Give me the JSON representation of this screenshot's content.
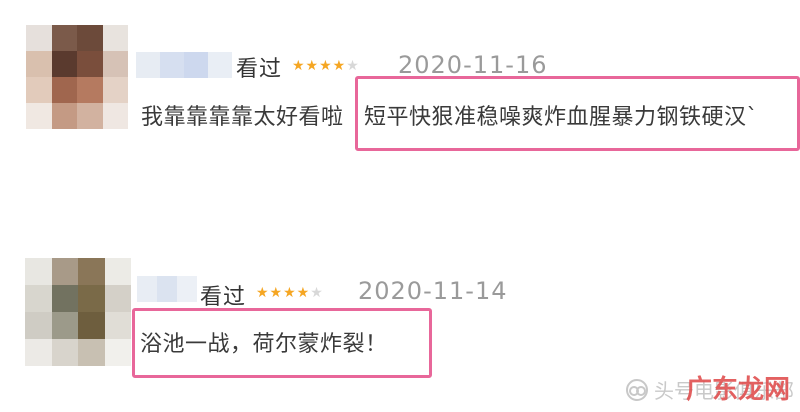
{
  "reviews": [
    {
      "status": "看过",
      "rating_stars": "★★★★",
      "rating_empty": "★",
      "rating": 4,
      "date": "2020-11-16",
      "comment_prefix": "我靠靠靠靠太好看啦",
      "comment_highlight": "短平快狠准稳噪爽炸血腥暴力钢铁硬汉`"
    },
    {
      "status": "看过",
      "rating_stars": "★★★★",
      "rating_empty": "★",
      "rating": 4,
      "date": "2020-11-14",
      "comment_prefix": "",
      "comment_highlight": "浴池一战，荷尔蒙炸裂！"
    }
  ],
  "watermark": {
    "text": "头号电影俱乐部",
    "site": "广东龙网"
  },
  "colors": {
    "highlight_border": "#e8679a",
    "star_on": "#f5a623",
    "star_off": "#d8d8d8",
    "date": "#9a9a9a"
  }
}
